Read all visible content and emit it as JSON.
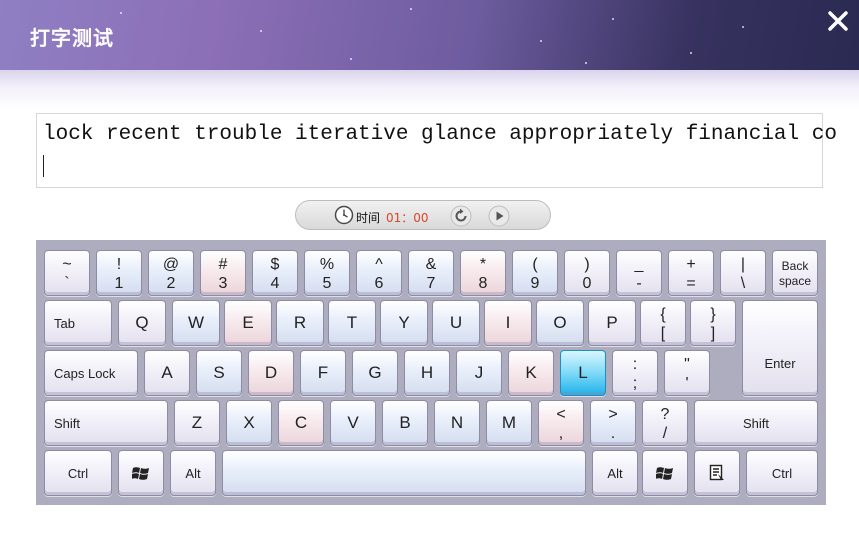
{
  "window": {
    "title": "打字测试"
  },
  "practice": {
    "target_text": "lock recent trouble iterative glance appropriately financial co",
    "typed_text": ""
  },
  "timer": {
    "label": "时间",
    "value": "01：00"
  },
  "keyboard": {
    "row1": [
      {
        "top": "~",
        "bottom": "`"
      },
      {
        "top": "!",
        "bottom": "1"
      },
      {
        "top": "@",
        "bottom": "2"
      },
      {
        "top": "#",
        "bottom": "3"
      },
      {
        "top": "$",
        "bottom": "4"
      },
      {
        "top": "%",
        "bottom": "5"
      },
      {
        "top": "^",
        "bottom": "6"
      },
      {
        "top": "&",
        "bottom": "7"
      },
      {
        "top": "*",
        "bottom": "8"
      },
      {
        "top": "(",
        "bottom": "9"
      },
      {
        "top": ")",
        "bottom": "0"
      },
      {
        "top": "_",
        "bottom": "-"
      },
      {
        "top": "+",
        "bottom": "="
      },
      {
        "top": "|",
        "bottom": "\\"
      },
      {
        "top": "Back",
        "bottom": "space"
      }
    ],
    "row2": [
      "Tab",
      "Q",
      "W",
      "E",
      "R",
      "T",
      "Y",
      "U",
      "I",
      "O",
      "P",
      "{",
      "[",
      "}",
      "]",
      "Enter"
    ],
    "row3": [
      "Caps Lock",
      "A",
      "S",
      "D",
      "F",
      "G",
      "H",
      "J",
      "K",
      "L",
      ":",
      ";",
      "\"",
      "'"
    ],
    "row4": [
      "Shift",
      "Z",
      "X",
      "C",
      "V",
      "B",
      "N",
      "M",
      "<",
      ",",
      ">",
      ".",
      "?",
      "/",
      "Shift"
    ],
    "row5": [
      "Ctrl",
      "Alt",
      "Alt",
      "Ctrl"
    ],
    "highlighted_key": "L"
  },
  "icons": {
    "close": "close-icon",
    "timer": "clock-icon",
    "reset": "reset-icon",
    "play": "play-icon",
    "windows": "windows-logo-icon",
    "menu": "context-menu-icon"
  },
  "colors": {
    "header_start": "#8f7fc3",
    "header_end": "#2a2a52",
    "timer_value": "#d9452b",
    "highlight_key": "#1fb3ea"
  }
}
